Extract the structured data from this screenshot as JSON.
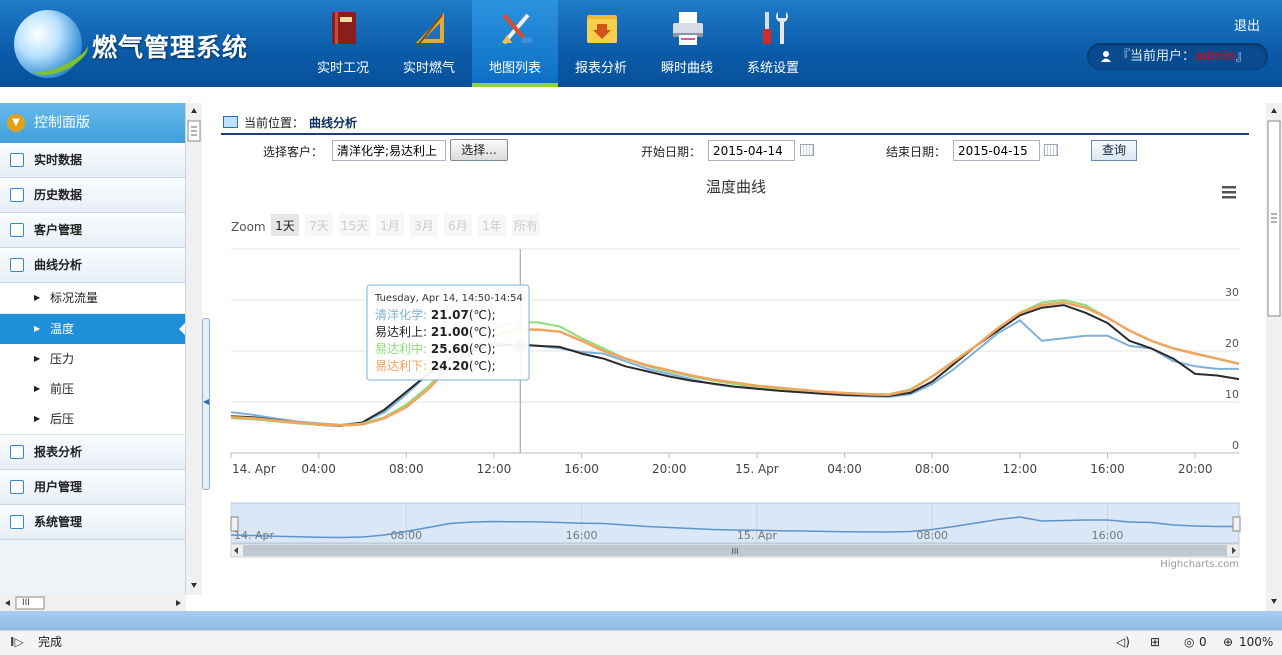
{
  "header": {
    "app_title": "燃气管理系统",
    "logout": "退出",
    "user_prefix": "『当前用户：",
    "user_name": "admin",
    "user_suffix": "』",
    "nav": [
      {
        "label": "实时工况",
        "icon": "book-icon"
      },
      {
        "label": "实时燃气",
        "icon": "ruler-icon"
      },
      {
        "label": "地图列表",
        "icon": "tools-icon",
        "active": true
      },
      {
        "label": "报表分析",
        "icon": "folder-download-icon"
      },
      {
        "label": "瞬时曲线",
        "icon": "printer-icon"
      },
      {
        "label": "系统设置",
        "icon": "wrench-icon"
      }
    ],
    "accent_color": "#8bd340"
  },
  "sidebar": {
    "header": "控制面版",
    "items": [
      {
        "label": "实时数据"
      },
      {
        "label": "历史数据"
      },
      {
        "label": "客户管理"
      },
      {
        "label": "曲线分析"
      }
    ],
    "sub_items": [
      {
        "label": "标况流量"
      },
      {
        "label": "温度",
        "active": true
      },
      {
        "label": "压力"
      },
      {
        "label": "前压"
      },
      {
        "label": "后压"
      }
    ],
    "items_after": [
      {
        "label": "报表分析"
      },
      {
        "label": "用户管理"
      },
      {
        "label": "系统管理"
      }
    ],
    "hscroll_thumb": "III"
  },
  "location": {
    "label": "当前位置：",
    "value": "曲线分析"
  },
  "filters": {
    "customer_label": "选择客户：",
    "customer_value": "清洋化学;易达利上",
    "select_button": "选择...",
    "start_label": "开始日期：",
    "start_value": "2015-04-14",
    "end_label": "结束日期：",
    "end_value": "2015-04-15",
    "query_button": "查询"
  },
  "chart_data": {
    "type": "line",
    "title": "温度曲线",
    "zoom_label": "Zoom",
    "range_buttons": [
      {
        "label": "1天",
        "active": true
      },
      {
        "label": "7天"
      },
      {
        "label": "15天"
      },
      {
        "label": "1月"
      },
      {
        "label": "3月"
      },
      {
        "label": "6月"
      },
      {
        "label": "1年"
      },
      {
        "label": "所有"
      }
    ],
    "x_unit": "hour offset from 2015-04-14 00:00",
    "x_range": [
      0,
      46
    ],
    "x_ticks": [
      {
        "x": 0,
        "label": "14. Apr"
      },
      {
        "x": 4,
        "label": "04:00"
      },
      {
        "x": 8,
        "label": "08:00"
      },
      {
        "x": 12,
        "label": "12:00"
      },
      {
        "x": 16,
        "label": "16:00"
      },
      {
        "x": 20,
        "label": "20:00"
      },
      {
        "x": 24,
        "label": "15. Apr"
      },
      {
        "x": 28,
        "label": "04:00"
      },
      {
        "x": 32,
        "label": "08:00"
      },
      {
        "x": 36,
        "label": "12:00"
      },
      {
        "x": 40,
        "label": "16:00"
      },
      {
        "x": 44,
        "label": "20:00"
      }
    ],
    "ylim": [
      0,
      40
    ],
    "y_ticks": [
      0,
      10,
      20,
      30
    ],
    "series": [
      {
        "name": "清洋化学",
        "color": "#7fb1d9",
        "points": [
          [
            0,
            8.0
          ],
          [
            1,
            7.5
          ],
          [
            2,
            6.8
          ],
          [
            3,
            6.2
          ],
          [
            4,
            5.8
          ],
          [
            5,
            5.5
          ],
          [
            6,
            6.0
          ],
          [
            7,
            8.0
          ],
          [
            8,
            11.5
          ],
          [
            9,
            15.5
          ],
          [
            10,
            19.5
          ],
          [
            11,
            21.0
          ],
          [
            12,
            21.5
          ],
          [
            13,
            21.2
          ],
          [
            14,
            21.07
          ],
          [
            15,
            20.5
          ],
          [
            16,
            19.8
          ],
          [
            17,
            19.5
          ],
          [
            18,
            18.0
          ],
          [
            19,
            16.5
          ],
          [
            20,
            15.5
          ],
          [
            21,
            14.5
          ],
          [
            22,
            13.5
          ],
          [
            23,
            13.0
          ],
          [
            24,
            12.7
          ],
          [
            25,
            12.3
          ],
          [
            26,
            12.0
          ],
          [
            27,
            11.6
          ],
          [
            28,
            11.3
          ],
          [
            29,
            11.1
          ],
          [
            30,
            11.0
          ],
          [
            31,
            11.5
          ],
          [
            32,
            13.5
          ],
          [
            33,
            16.5
          ],
          [
            34,
            20.0
          ],
          [
            35,
            23.5
          ],
          [
            36,
            26.0
          ],
          [
            37,
            22.0
          ],
          [
            38,
            22.5
          ],
          [
            39,
            23.0
          ],
          [
            40,
            23.0
          ],
          [
            41,
            21.0
          ],
          [
            42,
            20.5
          ],
          [
            43,
            18.0
          ],
          [
            44,
            17.0
          ],
          [
            45,
            16.5
          ],
          [
            46,
            16.5
          ]
        ]
      },
      {
        "name": "易达利上",
        "color": "#2b2b2b",
        "points": [
          [
            0,
            7.2
          ],
          [
            1,
            7.0
          ],
          [
            2,
            6.5
          ],
          [
            3,
            6.0
          ],
          [
            4,
            5.5
          ],
          [
            5,
            5.3
          ],
          [
            6,
            6.0
          ],
          [
            7,
            8.5
          ],
          [
            8,
            12.0
          ],
          [
            9,
            15.5
          ],
          [
            10,
            18.5
          ],
          [
            11,
            20.0
          ],
          [
            12,
            21.0
          ],
          [
            13,
            21.3
          ],
          [
            14,
            21.0
          ],
          [
            15,
            20.8
          ],
          [
            16,
            19.5
          ],
          [
            17,
            18.5
          ],
          [
            18,
            17.0
          ],
          [
            19,
            16.0
          ],
          [
            20,
            15.0
          ],
          [
            21,
            14.2
          ],
          [
            22,
            13.6
          ],
          [
            23,
            13.0
          ],
          [
            24,
            12.6
          ],
          [
            25,
            12.2
          ],
          [
            26,
            11.9
          ],
          [
            27,
            11.6
          ],
          [
            28,
            11.4
          ],
          [
            29,
            11.3
          ],
          [
            30,
            11.2
          ],
          [
            31,
            11.8
          ],
          [
            32,
            14.0
          ],
          [
            33,
            17.5
          ],
          [
            34,
            21.0
          ],
          [
            35,
            24.0
          ],
          [
            36,
            27.0
          ],
          [
            37,
            28.5
          ],
          [
            38,
            29.0
          ],
          [
            39,
            27.5
          ],
          [
            40,
            25.5
          ],
          [
            41,
            22.0
          ],
          [
            42,
            20.5
          ],
          [
            43,
            18.5
          ],
          [
            44,
            15.5
          ],
          [
            45,
            15.2
          ],
          [
            46,
            14.5
          ]
        ]
      },
      {
        "name": "易达利中",
        "color": "#8fdc7a",
        "points": [
          [
            0,
            6.8
          ],
          [
            1,
            6.6
          ],
          [
            2,
            6.2
          ],
          [
            3,
            5.8
          ],
          [
            4,
            5.5
          ],
          [
            5,
            5.4
          ],
          [
            6,
            5.8
          ],
          [
            7,
            7.0
          ],
          [
            8,
            9.5
          ],
          [
            9,
            13.0
          ],
          [
            10,
            17.5
          ],
          [
            11,
            21.5
          ],
          [
            12,
            24.5
          ],
          [
            13,
            25.6
          ],
          [
            14,
            25.6
          ],
          [
            15,
            24.8
          ],
          [
            16,
            22.5
          ],
          [
            17,
            20.5
          ],
          [
            18,
            18.5
          ],
          [
            19,
            17.0
          ],
          [
            20,
            16.0
          ],
          [
            21,
            15.0
          ],
          [
            22,
            14.2
          ],
          [
            23,
            13.5
          ],
          [
            24,
            13.0
          ],
          [
            25,
            12.6
          ],
          [
            26,
            12.3
          ],
          [
            27,
            12.0
          ],
          [
            28,
            11.8
          ],
          [
            29,
            11.6
          ],
          [
            30,
            11.5
          ],
          [
            31,
            12.5
          ],
          [
            32,
            15.0
          ],
          [
            33,
            18.0
          ],
          [
            34,
            21.0
          ],
          [
            35,
            24.5
          ],
          [
            36,
            27.5
          ],
          [
            37,
            29.5
          ],
          [
            38,
            30.0
          ],
          [
            39,
            29.0
          ],
          [
            40,
            26.5
          ],
          [
            41,
            24.0
          ],
          [
            42,
            22.0
          ],
          [
            43,
            20.5
          ],
          [
            44,
            19.5
          ],
          [
            45,
            18.5
          ],
          [
            46,
            17.5
          ]
        ]
      },
      {
        "name": "易达利下",
        "color": "#f0a45e",
        "points": [
          [
            0,
            7.0
          ],
          [
            1,
            6.8
          ],
          [
            2,
            6.4
          ],
          [
            3,
            6.0
          ],
          [
            4,
            5.6
          ],
          [
            5,
            5.4
          ],
          [
            6,
            5.6
          ],
          [
            7,
            6.8
          ],
          [
            8,
            9.0
          ],
          [
            9,
            12.5
          ],
          [
            10,
            17.0
          ],
          [
            11,
            20.5
          ],
          [
            12,
            23.0
          ],
          [
            13,
            24.2
          ],
          [
            14,
            24.2
          ],
          [
            15,
            23.8
          ],
          [
            16,
            22.0
          ],
          [
            17,
            20.0
          ],
          [
            18,
            18.5
          ],
          [
            19,
            17.2
          ],
          [
            20,
            16.2
          ],
          [
            21,
            15.2
          ],
          [
            22,
            14.4
          ],
          [
            23,
            13.8
          ],
          [
            24,
            13.2
          ],
          [
            25,
            12.8
          ],
          [
            26,
            12.4
          ],
          [
            27,
            12.0
          ],
          [
            28,
            11.7
          ],
          [
            29,
            11.5
          ],
          [
            30,
            11.4
          ],
          [
            31,
            12.3
          ],
          [
            32,
            15.0
          ],
          [
            33,
            18.0
          ],
          [
            34,
            21.0
          ],
          [
            35,
            24.5
          ],
          [
            36,
            27.5
          ],
          [
            37,
            29.0
          ],
          [
            38,
            29.5
          ],
          [
            39,
            28.5
          ],
          [
            40,
            26.5
          ],
          [
            41,
            24.0
          ],
          [
            42,
            22.0
          ],
          [
            43,
            20.5
          ],
          [
            44,
            19.5
          ],
          [
            45,
            18.5
          ],
          [
            46,
            17.5
          ]
        ]
      }
    ],
    "tooltip": {
      "header": "Tuesday, Apr 14, 14:50-14:54",
      "x": 13.2,
      "rows": [
        {
          "name": "清洋化学",
          "value": "21.07",
          "unit": "(℃);",
          "color": "#7fb1d9"
        },
        {
          "name": "易达利上",
          "value": "21.00",
          "unit": "(℃);",
          "color": "#222222"
        },
        {
          "name": "易达利中",
          "value": "25.60",
          "unit": "(℃);",
          "color": "#8fdc7a"
        },
        {
          "name": "易达利下",
          "value": "24.20",
          "unit": "(℃);",
          "color": "#f0a45e"
        }
      ]
    },
    "navigator": {
      "ticks": [
        {
          "x": 0,
          "label": "14. Apr"
        },
        {
          "x": 8,
          "label": "08:00"
        },
        {
          "x": 16,
          "label": "16:00"
        },
        {
          "x": 24,
          "label": "15. Apr"
        },
        {
          "x": 32,
          "label": "08:00"
        },
        {
          "x": 40,
          "label": "16:00"
        }
      ],
      "scroll_thumb": "III"
    },
    "credits": "Highcharts.com",
    "grid": true
  },
  "statusbar": {
    "status": "完成",
    "zoom": "100%",
    "counter": "0"
  }
}
